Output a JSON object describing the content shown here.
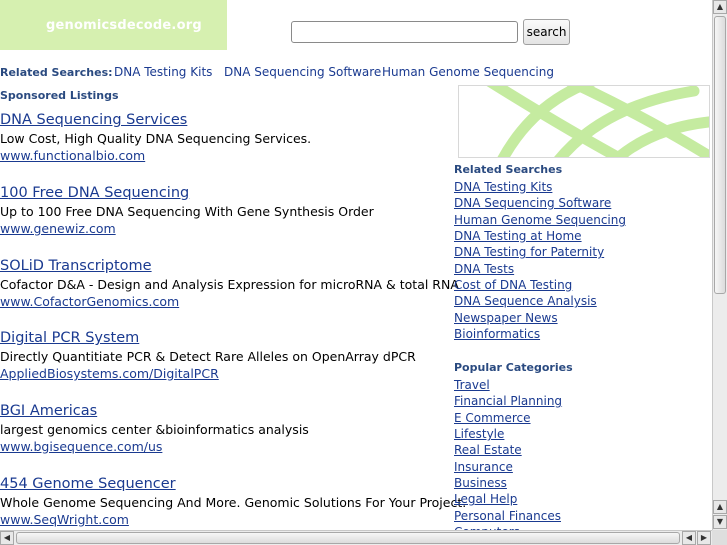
{
  "header": {
    "logo_text": "genomicsdecode.org",
    "search": {
      "value": "",
      "placeholder": ""
    },
    "search_button_label": "search"
  },
  "related_searches_top": {
    "label": "Related Searches:",
    "links": [
      "DNA Testing Kits",
      "DNA Sequencing Software",
      "Human Genome Sequencing"
    ]
  },
  "sponsored": {
    "label": "Sponsored Listings",
    "listings": [
      {
        "title": "DNA Sequencing Services",
        "description": "Low Cost, High Quality DNA Sequencing Services.",
        "url": "www.functionalbio.com"
      },
      {
        "title": "100 Free DNA Sequencing",
        "description": "Up to 100 Free DNA Sequencing With Gene Synthesis Order",
        "url": "www.genewiz.com"
      },
      {
        "title": "SOLiD Transcriptome",
        "description": "Cofactor D&A - Design and Analysis Expression for microRNA & total RNA",
        "url": "www.CofactorGenomics.com"
      },
      {
        "title": "Digital PCR System",
        "description": "Directly Quantitiate PCR & Detect Rare Alleles on OpenArray dPCR",
        "url": "AppliedBiosystems.com/DigitalPCR"
      },
      {
        "title": "BGI Americas",
        "description": "largest genomics center &bioinformatics analysis",
        "url": "www.bgisequence.com/us"
      },
      {
        "title": "454 Genome Sequencer",
        "description": "Whole Genome Sequencing And More. Genomic Solutions For Your Project.",
        "url": "www.SeqWright.com"
      }
    ]
  },
  "sidebar": {
    "related_heading": "Related Searches",
    "related_links": [
      "DNA Testing Kits",
      "DNA Sequencing Software",
      "Human Genome Sequencing",
      "DNA Testing at Home",
      "DNA Testing for Paternity",
      "DNA Tests",
      "Cost of DNA Testing",
      "DNA Sequence Analysis",
      "Newspaper News",
      "Bioinformatics"
    ],
    "popular_heading": "Popular Categories",
    "popular_links": [
      "Travel",
      "Financial Planning",
      "E Commerce",
      "Lifestyle",
      "Real Estate",
      "Insurance",
      "Business",
      "Legal Help",
      "Personal Finances",
      "Computers"
    ]
  },
  "colors": {
    "logo_background": "#d6f0b0",
    "link": "#1a3a90",
    "heading": "#2a4a80"
  },
  "icons": {
    "scroll_up": "up-arrow-icon",
    "scroll_down": "down-arrow-icon",
    "scroll_left": "left-arrow-icon",
    "scroll_right": "right-arrow-icon"
  }
}
